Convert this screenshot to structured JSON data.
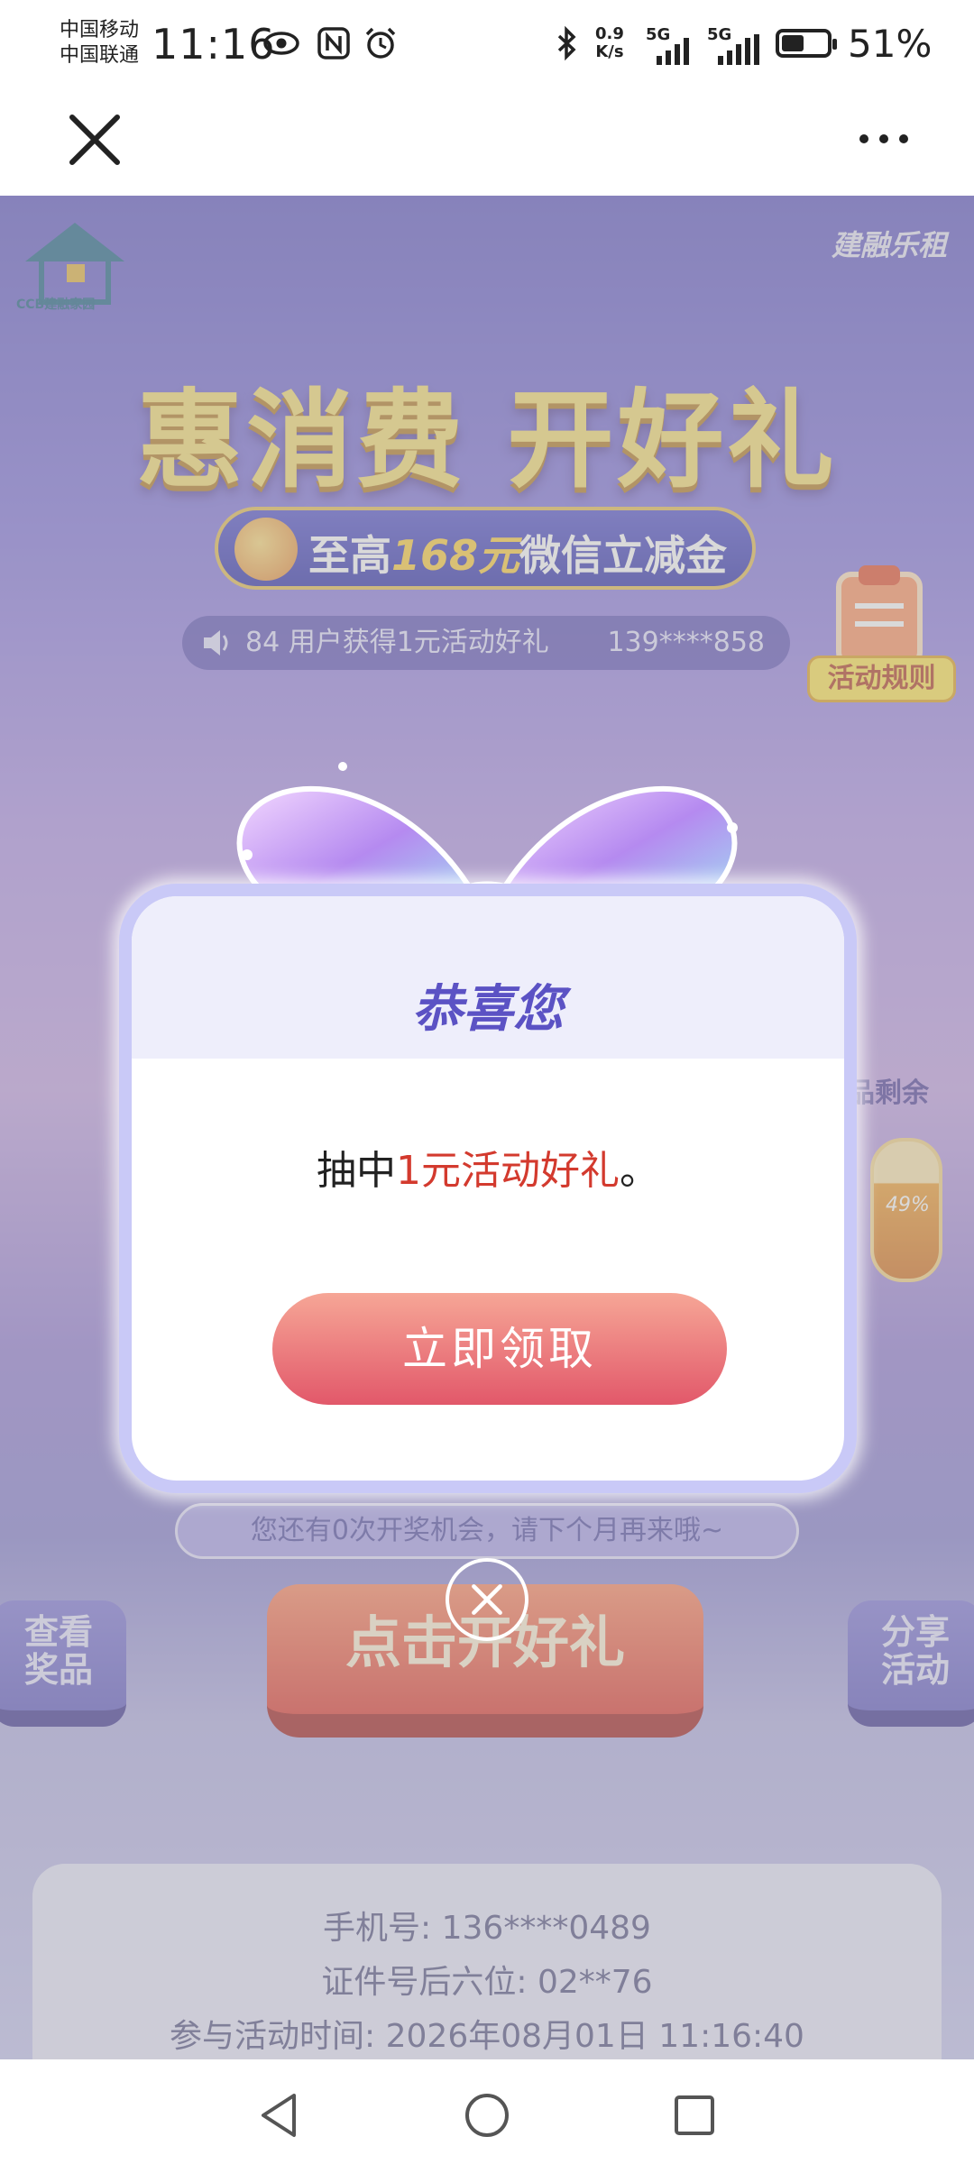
{
  "status_bar": {
    "carrier_1": "中国移动",
    "carrier_2": "中国联通",
    "time": "11:16",
    "net_speed_value": "0.9",
    "net_speed_unit": "K/s",
    "sim1_network": "5G",
    "sim2_network": "5G",
    "battery_percent": "51%",
    "battery_level": 0.51
  },
  "title_bar": {
    "close_icon": "close-icon",
    "more_icon": "more-dots-icon"
  },
  "page": {
    "brand_left": "CCB建融家园",
    "brand_right": "建融乐租",
    "headline": "惠消费 开好礼",
    "subbanner_prefix": "至高",
    "subbanner_amount": "168元",
    "subbanner_suffix": "微信立减金",
    "ticker_message": "84 用户获得1元活动好礼",
    "ticker_phone": "139****858",
    "rules_label": "活动规则",
    "side_label": "品剩余",
    "side_percent": "49%",
    "chance_text": "您还有0次开奖机会，请下个月再来哦~",
    "view_prizes_label": "查看\n奖品",
    "open_gift_label": "点击开好礼",
    "share_label": "分享\n活动",
    "phone_line": "手机号: 136****0489",
    "id_line": "证件号后六位: 02**76",
    "time_line": "参与活动时间: 2026年08月01日 11:16:40"
  },
  "modal": {
    "title": "恭喜您",
    "message_prefix": "抽中",
    "message_prize": "1元活动好礼",
    "message_suffix": "。",
    "claim_button": "立即领取",
    "close_icon": "close-circle-icon"
  },
  "nav_bar": {
    "back_icon": "back-triangle-icon",
    "home_icon": "home-circle-icon",
    "recent_icon": "recent-square-icon"
  },
  "colors": {
    "title_purple": "#5b52c4",
    "prize_red": "#d33a2e",
    "claim_button_top": "#f6a696",
    "claim_button_bottom": "#e2586a"
  }
}
